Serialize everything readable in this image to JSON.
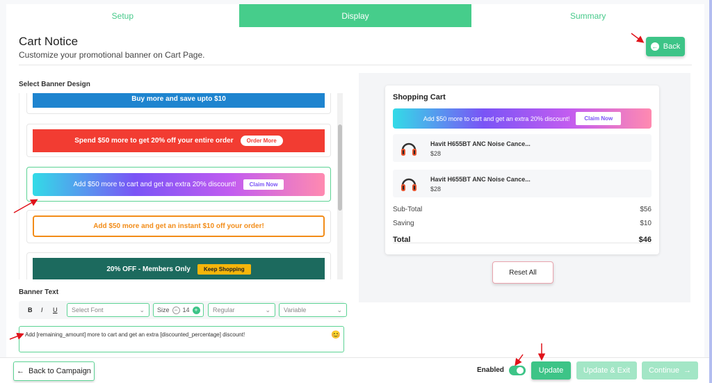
{
  "tabs": [
    {
      "label": "Setup",
      "active": false
    },
    {
      "label": "Display",
      "active": true
    },
    {
      "label": "Summary",
      "active": false
    }
  ],
  "header": {
    "title": "Cart Notice",
    "subtitle": "Customize your promotional banner on Cart Page.",
    "back_label": "Back",
    "back_icon": "arrow-left-circle-icon"
  },
  "designs": {
    "section_label": "Select Banner Design",
    "items": [
      {
        "text": "Buy more and save upto $10",
        "button": ""
      },
      {
        "text": "Spend $50 more to get 20% off your entire order",
        "button": "Order More"
      },
      {
        "text": "Add $50 more to cart and get an extra 20% discount!",
        "button": "Claim Now"
      },
      {
        "text": "Add $50 more and get an instant $10 off your order!",
        "button": ""
      },
      {
        "text": "20% OFF - Members Only",
        "button": "Keep Shopping"
      }
    ],
    "selected_index": 2
  },
  "editor": {
    "label": "Banner Text",
    "bold": "B",
    "italic": "I",
    "underline": "U",
    "font_placeholder": "Select Font",
    "size_label": "Size",
    "size_value": "14",
    "size_minus": "−",
    "size_plus": "+",
    "weight_value": "Regular",
    "variable_value": "Variable",
    "text_value": "Add [remaining_amount] more to cart and get an extra [discounted_percentage] discount!",
    "emoji": "😊"
  },
  "preview": {
    "cart_title": "Shopping Cart",
    "banner_text": "Add $50 more to cart and get an extra 20% discount!",
    "banner_button": "Claim Now",
    "items": [
      {
        "name": "Havit H655BT ANC Noise Cance...",
        "price": "$28",
        "icon": "headphones-icon"
      },
      {
        "name": "Havit H655BT ANC Noise Cance...",
        "price": "$28",
        "icon": "headphones-icon"
      }
    ],
    "subtotal_label": "Sub-Total",
    "subtotal_value": "$56",
    "saving_label": "Saving",
    "saving_value": "$10",
    "total_label": "Total",
    "total_value": "$46",
    "reset_label": "Reset All"
  },
  "footer": {
    "back_campaign_label": "Back to Campaign",
    "enabled_label": "Enabled",
    "enabled": true,
    "update_label": "Update",
    "update_exit_label": "Update & Exit",
    "continue_label": "Continue",
    "continue_arrow": "→",
    "back_arrow": "←"
  },
  "colors": {
    "accent": "#3dc487",
    "accent_light": "#a3e6c6",
    "banner_blue": "#1e84cf",
    "banner_red": "#f23c32",
    "banner_orange": "#f28c18",
    "banner_teal": "#1c6a5e",
    "banner_yellow": "#f5b50b",
    "annotation_red": "#e0131b"
  }
}
